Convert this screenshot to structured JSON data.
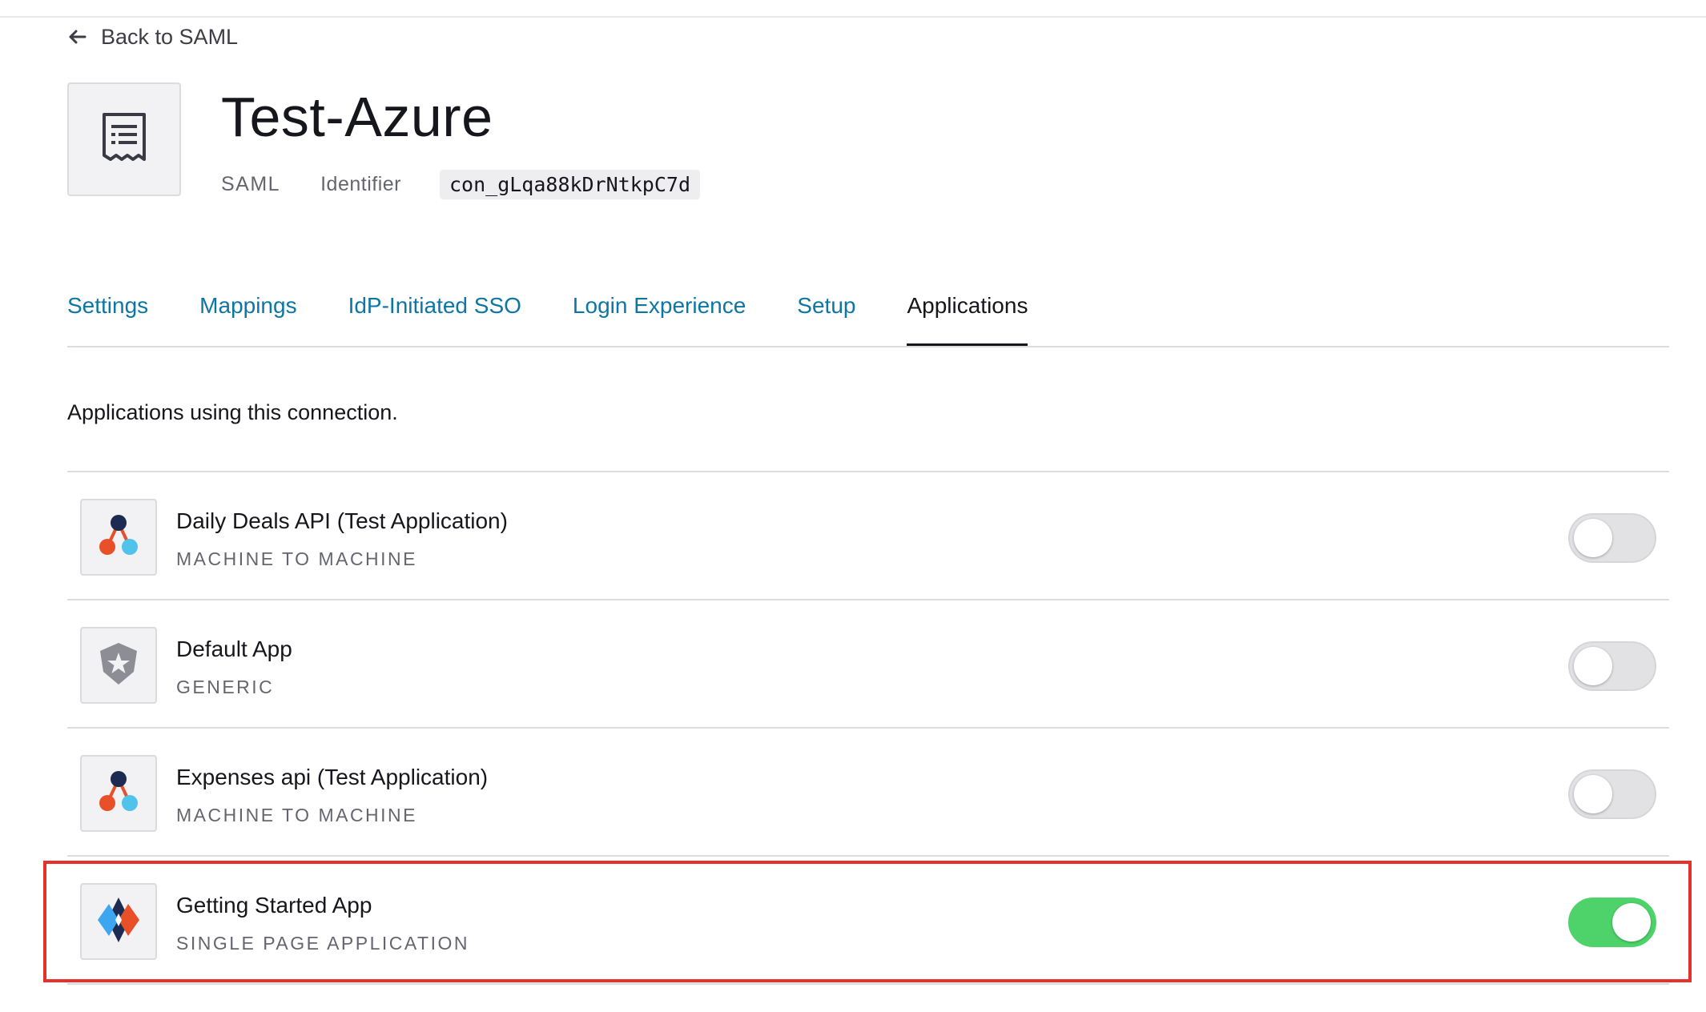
{
  "header": {
    "back_label": "Back to SAML",
    "title": "Test-Azure",
    "type": "SAML",
    "identifier_label": "Identifier",
    "identifier_value": "con_gLqa88kDrNtkpC7d"
  },
  "tabs": [
    {
      "label": "Settings",
      "active": false
    },
    {
      "label": "Mappings",
      "active": false
    },
    {
      "label": "IdP-Initiated SSO",
      "active": false
    },
    {
      "label": "Login Experience",
      "active": false
    },
    {
      "label": "Setup",
      "active": false
    },
    {
      "label": "Applications",
      "active": true
    }
  ],
  "applications": {
    "description": "Applications using this connection.",
    "items": [
      {
        "name": "Daily Deals API (Test Application)",
        "type": "MACHINE TO MACHINE",
        "icon": "machine-to-machine-icon",
        "enabled": false
      },
      {
        "name": "Default App",
        "type": "GENERIC",
        "icon": "shield-star-icon",
        "enabled": false
      },
      {
        "name": "Expenses api (Test Application)",
        "type": "MACHINE TO MACHINE",
        "icon": "machine-to-machine-icon",
        "enabled": false
      },
      {
        "name": "Getting Started App",
        "type": "SINGLE PAGE APPLICATION",
        "icon": "single-page-app-icon",
        "enabled": true
      }
    ]
  },
  "colors": {
    "link": "#0d76a4",
    "toggle_on": "#4ed36a",
    "toggle_off": "#e2e2e5",
    "highlight": "#e8302b"
  }
}
